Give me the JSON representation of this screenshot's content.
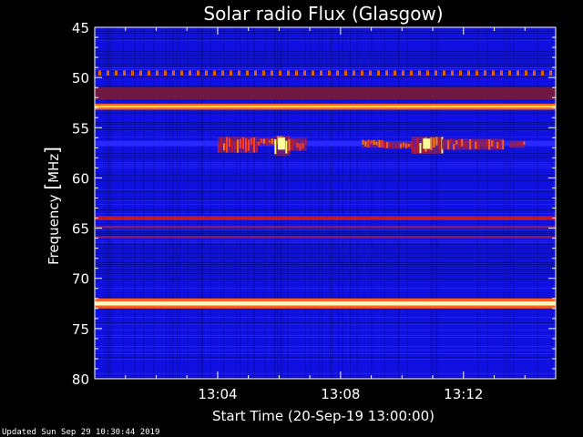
{
  "chart_data": {
    "type": "heatmap",
    "title": "Solar radio Flux (Glasgow)",
    "xlabel": "Start Time (20-Sep-19 13:00:00)",
    "ylabel_main": "Frequency ",
    "ylabel_bracket_open": "[",
    "ylabel_unit": "MHz",
    "ylabel_bracket_close": "]",
    "x_unit": "minutes after 13:00",
    "x_range": [
      0,
      15
    ],
    "x_ticks": [
      {
        "value": 4,
        "label": "13:04"
      },
      {
        "value": 8,
        "label": "13:08"
      },
      {
        "value": 12,
        "label": "13:12"
      }
    ],
    "y_range": [
      45,
      80
    ],
    "y_inverted": true,
    "y_ticks": [
      {
        "value": 45,
        "label": "45"
      },
      {
        "value": 50,
        "label": "50"
      },
      {
        "value": 55,
        "label": "55"
      },
      {
        "value": 60,
        "label": "60"
      },
      {
        "value": 65,
        "label": "65"
      },
      {
        "value": 70,
        "label": "70"
      },
      {
        "value": 75,
        "label": "75"
      },
      {
        "value": 80,
        "label": "80"
      }
    ],
    "colors": {
      "background": "#1010e0",
      "dark": "#08087a",
      "mid": "#3030ff",
      "band_red": "#c01830",
      "band_dark_red": "#701840",
      "hot_orange": "#ff8000",
      "hot_yellow": "#ffff40",
      "white": "#ffffe0"
    },
    "horizontal_bands": [
      {
        "freq_from": 49.3,
        "freq_to": 49.8,
        "color": "#e06010",
        "dashed": true
      },
      {
        "freq_from": 51.0,
        "freq_to": 52.2,
        "color": "#701840"
      },
      {
        "freq_from": 52.6,
        "freq_to": 53.2,
        "color": "#ff6020"
      },
      {
        "freq_from": 52.8,
        "freq_to": 53.0,
        "color": "#ffd040"
      },
      {
        "freq_from": 56.3,
        "freq_to": 56.8,
        "color": "#2828ff"
      },
      {
        "freq_from": 63.8,
        "freq_to": 64.2,
        "color": "#c01830"
      },
      {
        "freq_from": 64.8,
        "freq_to": 65.0,
        "color": "#8a2060"
      },
      {
        "freq_from": 65.8,
        "freq_to": 66.0,
        "color": "#8a2060"
      },
      {
        "freq_from": 72.0,
        "freq_to": 73.0,
        "color": "#ff6020"
      },
      {
        "freq_from": 72.3,
        "freq_to": 72.7,
        "color": "#ffffc0"
      }
    ],
    "bursts": [
      {
        "t_from": 4.0,
        "t_to": 5.3,
        "freq_from": 55.9,
        "freq_to": 57.5,
        "intensity": "high"
      },
      {
        "t_from": 5.3,
        "t_to": 5.85,
        "freq_from": 56.0,
        "freq_to": 56.8,
        "intensity": "high"
      },
      {
        "t_from": 5.85,
        "t_to": 6.3,
        "freq_from": 55.8,
        "freq_to": 57.8,
        "intensity": "peak"
      },
      {
        "t_from": 6.3,
        "t_to": 6.9,
        "freq_from": 56.0,
        "freq_to": 57.3,
        "intensity": "high"
      },
      {
        "t_from": 8.7,
        "t_to": 9.4,
        "freq_from": 56.2,
        "freq_to": 57.0,
        "intensity": "high"
      },
      {
        "t_from": 9.4,
        "t_to": 10.3,
        "freq_from": 56.4,
        "freq_to": 57.1,
        "intensity": "medium"
      },
      {
        "t_from": 10.3,
        "t_to": 11.3,
        "freq_from": 55.9,
        "freq_to": 57.6,
        "intensity": "peak"
      },
      {
        "t_from": 11.3,
        "t_to": 13.3,
        "freq_from": 56.1,
        "freq_to": 57.2,
        "intensity": "medium"
      },
      {
        "t_from": 13.5,
        "t_to": 14.0,
        "freq_from": 56.3,
        "freq_to": 57.0,
        "intensity": "medium"
      }
    ]
  },
  "footer": {
    "updated": "Updated Sun Sep 29 10:30:44 2019"
  }
}
